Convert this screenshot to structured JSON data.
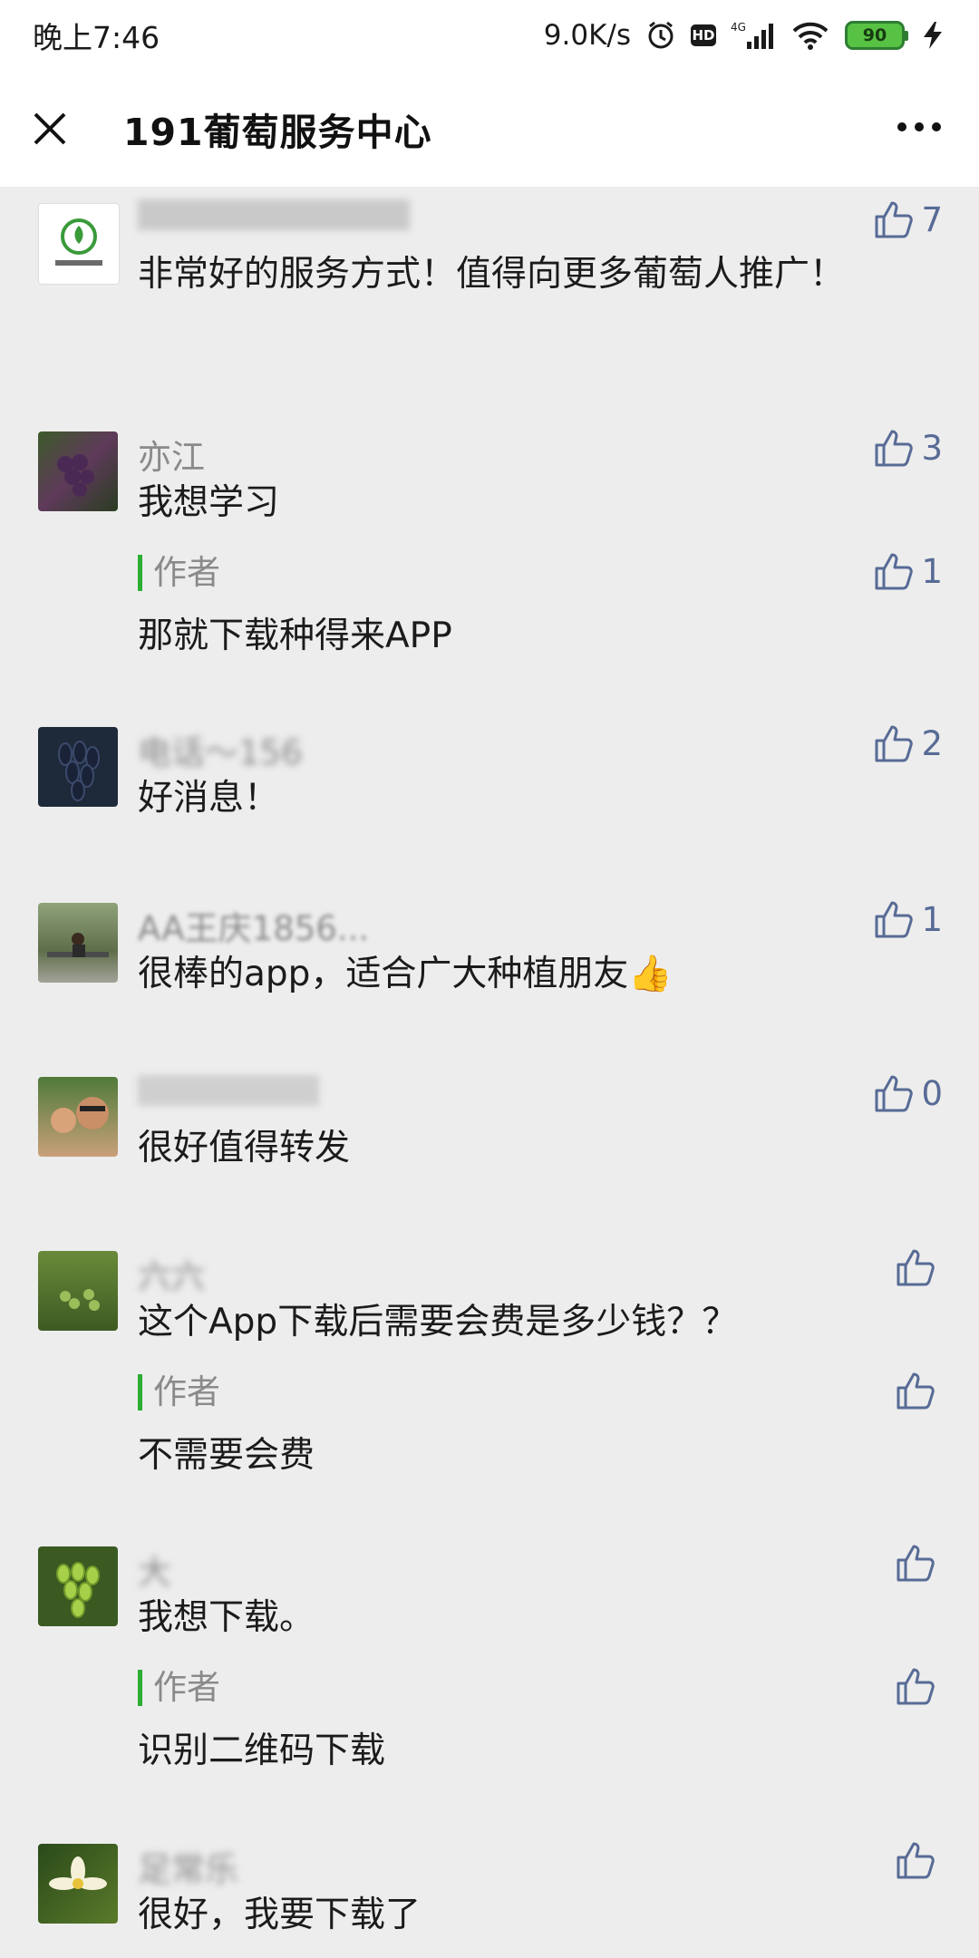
{
  "status_bar": {
    "time": "晚上7:46",
    "net_speed": "9.0K/s",
    "hd": "HD",
    "network": "4G",
    "battery": "90"
  },
  "nav": {
    "title": "191葡萄服务中心",
    "close_icon": "close-icon",
    "more_icon": "more-icon"
  },
  "colors": {
    "like_blue": "#576b95",
    "author_bar_green": "#2aae33",
    "background": "#ededed"
  },
  "comments": [
    {
      "nickname": "",
      "text": "非常好的服务方式！值得向更多葡萄人推广！",
      "likes": "7",
      "avatar": "logo-avatar"
    },
    {
      "nickname": "亦江",
      "text": "我想学习",
      "likes": "3",
      "avatar": "grapes-avatar",
      "reply": {
        "label": "作者",
        "text": "那就下载种得来APP",
        "likes": "1"
      }
    },
    {
      "nickname": "电话～156",
      "text": "好消息！",
      "likes": "2",
      "avatar": "black-grapes-avatar"
    },
    {
      "nickname": "AA王庆1856...",
      "text": "很棒的app，适合广大种植朋友👍",
      "likes": "1",
      "avatar": "person-bench-avatar"
    },
    {
      "nickname": "",
      "text": "很好值得转发",
      "likes": "0",
      "avatar": "family-avatar"
    },
    {
      "nickname": "六六",
      "text": "这个App下载后需要会费是多少钱？？",
      "likes": "",
      "avatar": "vine-avatar",
      "reply": {
        "label": "作者",
        "text": "不需要会费",
        "likes": ""
      }
    },
    {
      "nickname": "大",
      "text": "我想下载。",
      "likes": "",
      "avatar": "green-grapes-avatar",
      "reply": {
        "label": "作者",
        "text": "识别二维码下载",
        "likes": ""
      }
    },
    {
      "nickname": "足常乐",
      "text": "很好，我要下载了",
      "likes": "",
      "avatar": "flower-avatar"
    }
  ]
}
